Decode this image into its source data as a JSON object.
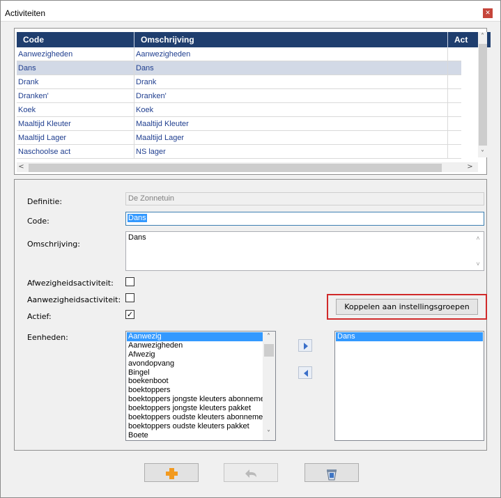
{
  "window": {
    "title": "Activiteiten",
    "close_icon": "close-icon"
  },
  "grid": {
    "columns": [
      "Code",
      "Omschrijving",
      "Act"
    ],
    "rows": [
      {
        "code": "Aanwezigheden",
        "omschrijving": "Aanwezigheden",
        "selected": false
      },
      {
        "code": "Dans",
        "omschrijving": "Dans",
        "selected": true
      },
      {
        "code": "Drank",
        "omschrijving": "Drank",
        "selected": false
      },
      {
        "code": "Dranken'",
        "omschrijving": "Dranken'",
        "selected": false
      },
      {
        "code": "Koek",
        "omschrijving": "Koek",
        "selected": false
      },
      {
        "code": "Maaltijd Kleuter",
        "omschrijving": "Maaltijd Kleuter",
        "selected": false
      },
      {
        "code": "Maaltijd Lager",
        "omschrijving": "Maaltijd Lager",
        "selected": false
      },
      {
        "code": "Naschoolse act",
        "omschrijving": "NS lager",
        "selected": false
      }
    ],
    "scroll_up": "˄",
    "scroll_down": "˅",
    "scroll_left": "<",
    "scroll_right": ">"
  },
  "form": {
    "definitie_label": "Definitie:",
    "definitie_value": "De Zonnetuin",
    "code_label": "Code:",
    "code_value": "Dans",
    "omschrijving_label": "Omschrijving:",
    "omschrijving_value": "Dans",
    "afwezig_label": "Afwezigheidsactiviteit:",
    "afwezig_checked": false,
    "aanwezig_label": "Aanwezigheidsactiviteit:",
    "aanwezig_checked": false,
    "actief_label": "Actief:",
    "actief_checked": true,
    "actief_mark": "✓",
    "koppelen_button": "Koppelen aan instellingsgroepen",
    "eenheden_label": "Eenheden:"
  },
  "eenheden_available": [
    {
      "label": "Aanwezig",
      "selected": true
    },
    {
      "label": "Aanwezigheden",
      "selected": false
    },
    {
      "label": "Afwezig",
      "selected": false
    },
    {
      "label": "avondopvang",
      "selected": false
    },
    {
      "label": "Bingel",
      "selected": false
    },
    {
      "label": "boekenboot",
      "selected": false
    },
    {
      "label": "boektoppers",
      "selected": false
    },
    {
      "label": "boektoppers jongste kleuters abonnemen",
      "selected": false
    },
    {
      "label": "boektoppers jongste kleuters pakket",
      "selected": false
    },
    {
      "label": "boektoppers oudste kleuters abonnemen",
      "selected": false
    },
    {
      "label": "boektoppers oudste kleuters pakket",
      "selected": false
    },
    {
      "label": "Boete",
      "selected": false
    }
  ],
  "eenheden_selected": [
    {
      "label": "Dans",
      "selected": true
    }
  ],
  "transfer": {
    "add_icon": "arrow-right-icon",
    "remove_icon": "arrow-left-icon"
  },
  "bottom_buttons": [
    {
      "name": "add-button",
      "icon": "plus-icon",
      "enabled": true
    },
    {
      "name": "undo-button",
      "icon": "undo-icon",
      "enabled": false
    },
    {
      "name": "delete-button",
      "icon": "trash-icon",
      "enabled": true
    }
  ],
  "colors": {
    "header_bg": "#1f3e6e",
    "selection": "#3399ff",
    "row_selected": "#d2d9e6",
    "highlight_border": "#d02a2a",
    "plus_orange": "#f29a1f"
  }
}
